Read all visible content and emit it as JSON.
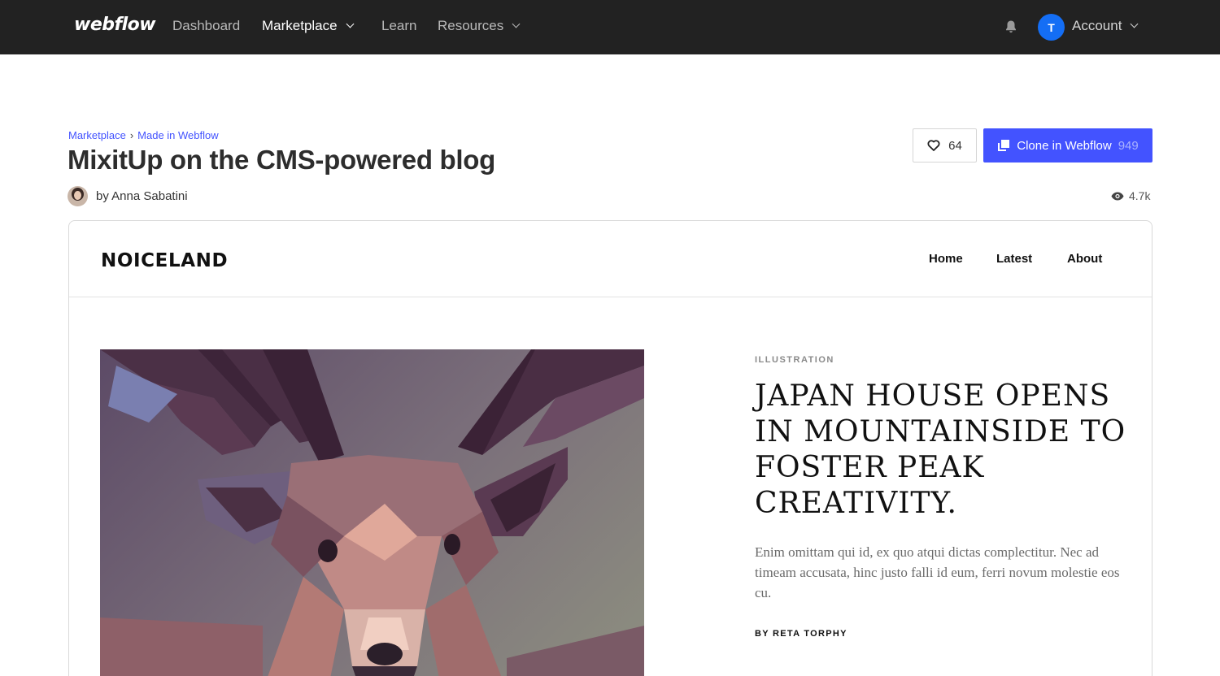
{
  "topnav": {
    "logo": "webflow",
    "links": [
      {
        "label": "Dashboard"
      },
      {
        "label": "Marketplace"
      },
      {
        "label": "Learn"
      },
      {
        "label": "Resources"
      }
    ],
    "avatar_initial": "T",
    "account_label": "Account"
  },
  "header": {
    "breadcrumb": [
      "Marketplace",
      "Made in Webflow"
    ],
    "breadcrumb_separator": "›",
    "title": "MixitUp on the CMS-powered blog",
    "author": "by Anna Sabatini",
    "likes": "64",
    "clone_label": "Clone in Webflow",
    "clone_count": "949",
    "views": "4.7k"
  },
  "preview": {
    "site_logo": "NOICELAND",
    "nav": [
      "Home",
      "Latest",
      "About"
    ],
    "category": "ILLUSTRATION",
    "headline": "JAPAN HOUSE OPENS IN MOUNTAINSIDE TO FOSTER PEAK CREATIVITY.",
    "excerpt": "Enim omittam qui id, ex quo atqui dictas complectitur. Nec ad timeam accusata, hinc justo falli id eum, ferri novum molestie eos cu.",
    "byline": "BY  RETA TORPHY"
  },
  "colors": {
    "nav_bg": "#222222",
    "accent": "#4353ff",
    "avatar": "#146ef5"
  }
}
